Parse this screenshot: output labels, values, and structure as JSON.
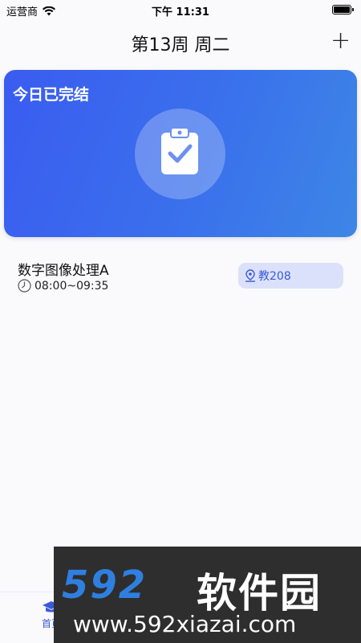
{
  "status_bar": {
    "carrier": "运营商",
    "time": "下午 11:31"
  },
  "nav": {
    "title": "第13周 周二",
    "add_label": "+"
  },
  "hero": {
    "title": "今日已完结",
    "icon": "clipboard-check-icon"
  },
  "course": {
    "name": "数字图像处理A",
    "time": "08:00~09:35",
    "location": "教208"
  },
  "tab_bar": {
    "home_label": "首页"
  },
  "watermark": {
    "logo": "592",
    "brand": "软件园",
    "url": "www.592xiazai.com"
  },
  "colors": {
    "accent": "#3a5ad8",
    "hero_start": "#3a5cf0",
    "hero_end": "#3d86e6",
    "pill_bg": "#dbe1fb"
  }
}
